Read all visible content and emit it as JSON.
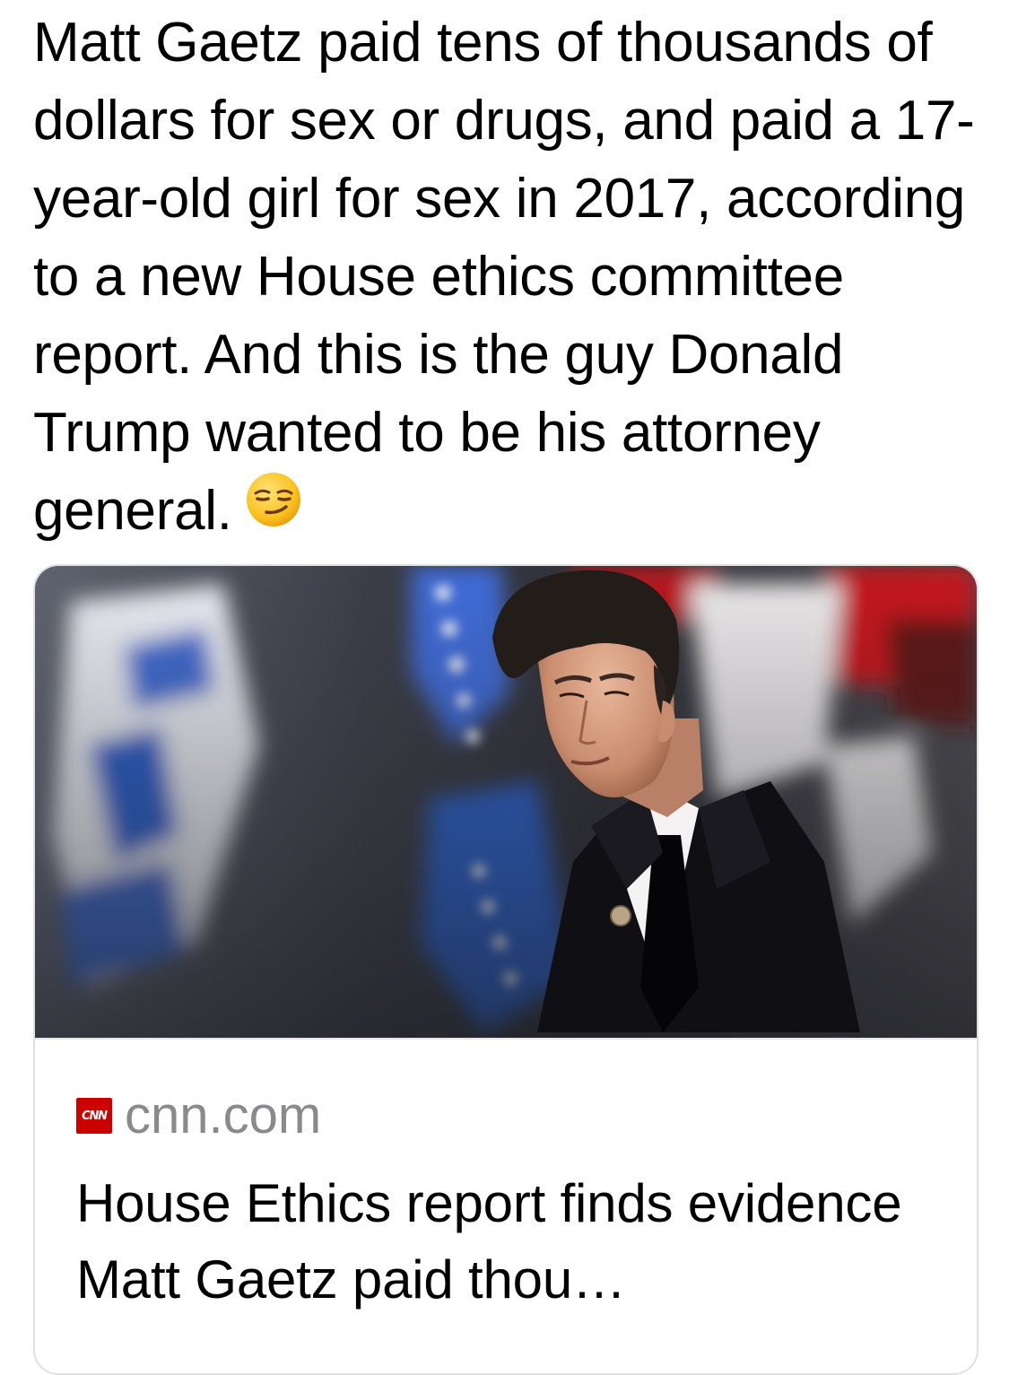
{
  "post": {
    "text": "Matt Gaetz paid tens of thousands of dollars for sex or drugs, and paid a 17-year-old girl for sex in 2017, according to a new House ethics committee report. And this is the guy Donald Trump wanted to be his attorney general.",
    "emoji_icon": "smirking-face-emoji"
  },
  "link_card": {
    "source_logo_text": "CNN",
    "source_domain": "cnn.com",
    "title": "House Ethics report finds evidence Matt Gaetz paid thou…",
    "logo_color": "#cc0000"
  }
}
